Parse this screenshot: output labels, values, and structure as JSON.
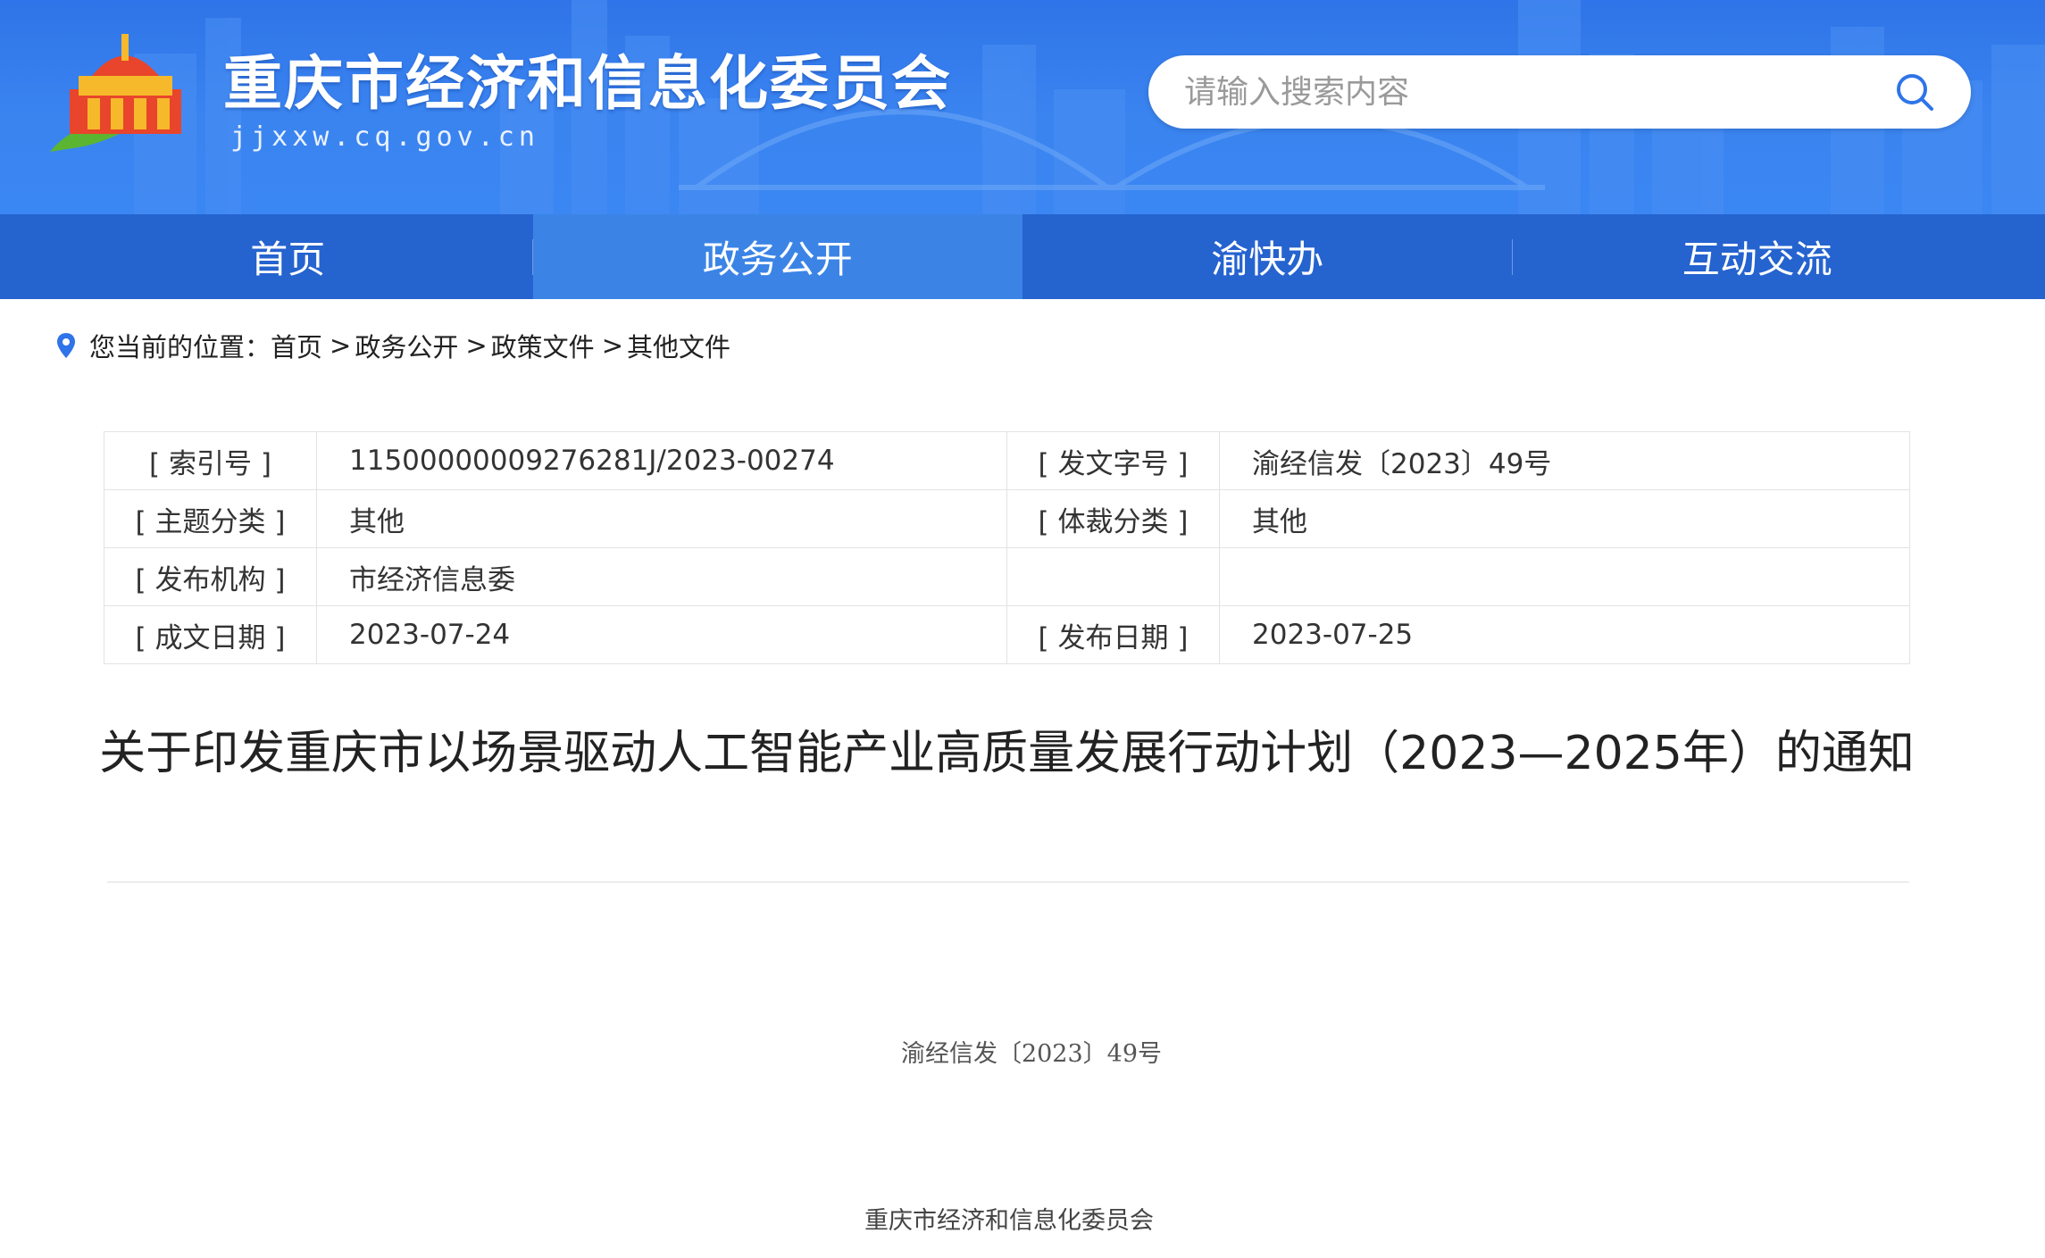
{
  "header": {
    "site_title": "重庆市经济和信息化委员会",
    "site_domain": "jjxxw.cq.gov.cn",
    "search_placeholder": "请输入搜索内容"
  },
  "nav": {
    "items": [
      {
        "label": "首页"
      },
      {
        "label": "政务公开"
      },
      {
        "label": "渝快办"
      },
      {
        "label": "互动交流"
      }
    ],
    "active_index": 1
  },
  "breadcrumb": {
    "prefix": "您当前的位置：",
    "items": [
      "首页",
      "政务公开",
      "政策文件",
      "其他文件"
    ],
    "separator": ">"
  },
  "info": {
    "index_label": "[ 索引号 ]",
    "index_value": "11500000009276281J/2023-00274",
    "doc_no_label": "[ 发文字号 ]",
    "doc_no_value": "渝经信发〔2023〕49号",
    "topic_label": "[ 主题分类 ]",
    "topic_value": "其他",
    "genre_label": "[ 体裁分类 ]",
    "genre_value": "其他",
    "publisher_label": "[ 发布机构 ]",
    "publisher_value": "市经济信息委",
    "created_label": "[ 成文日期 ]",
    "created_value": "2023-07-24",
    "published_label": "[ 发布日期 ]",
    "published_value": "2023-07-25"
  },
  "document": {
    "title": "关于印发重庆市以场景驱动人工智能产业高质量发展行动计划（2023—2025年）的通知",
    "doc_number": "渝经信发〔2023〕49号",
    "issuer": "重庆市经济和信息化委员会"
  },
  "colors": {
    "header_blue": "#2f74e8",
    "nav_blue": "#2563cf",
    "nav_active": "#3b84e6",
    "logo_red": "#e8452c",
    "logo_yellow": "#f6b92b",
    "logo_green": "#5cb531"
  }
}
